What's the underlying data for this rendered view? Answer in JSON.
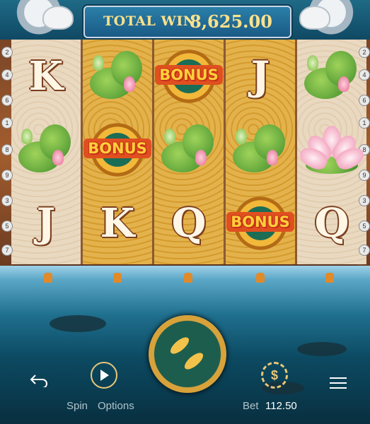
{
  "banner": {
    "label": "TOTAL WIN",
    "value": "8,625.00"
  },
  "reels": [
    [
      "K",
      "lotus-leaf",
      "J"
    ],
    [
      "lotus-leaf",
      "BONUS",
      "K"
    ],
    [
      "BONUS",
      "lotus-leaf",
      "Q"
    ],
    [
      "J",
      "lotus-leaf",
      "BONUS"
    ],
    [
      "lotus-leaf",
      "lotus-flower",
      "Q"
    ]
  ],
  "payline_numbers_left": [
    "2",
    "4",
    "6",
    "1",
    "8",
    "9",
    "3",
    "5",
    "7"
  ],
  "payline_numbers_right": [
    "2",
    "4",
    "6",
    "1",
    "8",
    "9",
    "3",
    "5",
    "7"
  ],
  "bonus_label": "BONUS",
  "controls": {
    "spin_label": "Spin",
    "options_label": "Options",
    "bet_label": "Bet",
    "bet_value": "112.50",
    "coin_symbol": "$"
  },
  "colors": {
    "win_text": "#ffe28a",
    "bonus_text": "#ffcf3a",
    "water_top": "#9fd1e8",
    "water_bottom": "#082f3f"
  },
  "icons": [
    "back-arrow-icon",
    "play-icon",
    "koi-spin-icon",
    "coin-dollar-icon",
    "menu-icon"
  ]
}
